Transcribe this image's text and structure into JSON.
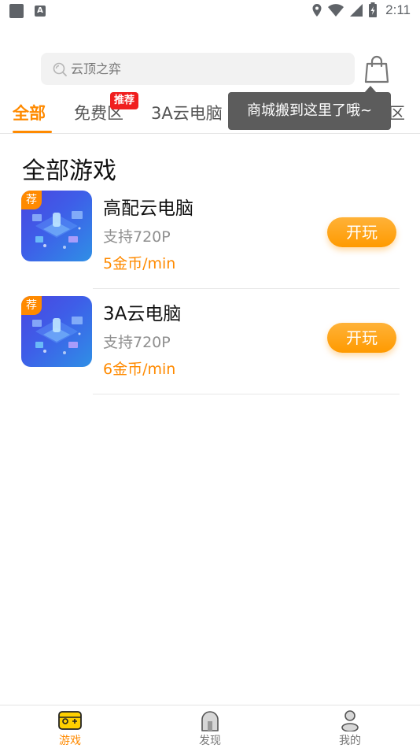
{
  "status_bar": {
    "time": "2:11",
    "notification_icons": [
      "square-notification-icon",
      "a-notification-icon"
    ],
    "system_icons": [
      "location-icon",
      "wifi-icon",
      "signal-icon",
      "battery-charging-icon"
    ]
  },
  "search": {
    "placeholder": "云顶之弈",
    "icon": "search-icon"
  },
  "header": {
    "bag_icon": "shopping-bag-icon"
  },
  "tabs": [
    {
      "label": "全部",
      "active": true
    },
    {
      "label": "免费区",
      "badge": "推荐"
    },
    {
      "label": "3A云电脑"
    },
    {
      "label": "区"
    }
  ],
  "tooltip": {
    "text": "商城搬到这里了哦~"
  },
  "section": {
    "title": "全部游戏"
  },
  "games": [
    {
      "tag": "荐",
      "title": "高配云电脑",
      "spec": "支持720P",
      "price": "5金币/min",
      "button": "开玩"
    },
    {
      "tag": "荐",
      "title": "3A云电脑",
      "spec": "支持720P",
      "price": "6金币/min",
      "button": "开玩"
    }
  ],
  "bottom_nav": [
    {
      "label": "游戏",
      "icon": "gamepad-icon",
      "active": true
    },
    {
      "label": "发现",
      "icon": "discover-icon"
    },
    {
      "label": "我的",
      "icon": "profile-icon"
    }
  ],
  "colors": {
    "accent": "#ff8a00",
    "badge": "#f01e1e",
    "tooltip_bg": "#5c5c5c"
  }
}
